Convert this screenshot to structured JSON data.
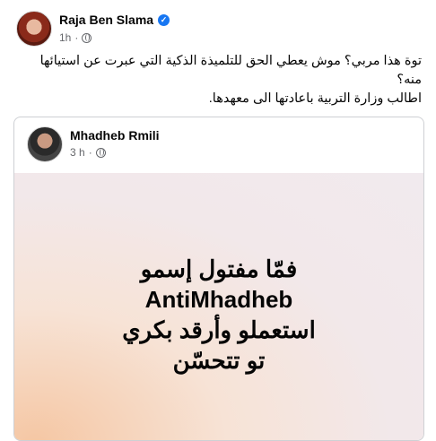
{
  "post": {
    "author": "Raja Ben Slama",
    "verified_icon": "verified-badge-icon",
    "time": "1h",
    "separator": "·",
    "privacy_icon": "globe-icon",
    "text_line1": "توة هذا مربي؟ موش يعطي الحق للتلميذة الذكية التي عبرت عن استيائها",
    "text_line2": "منه؟",
    "text_line3": "اطالب وزارة التربية باعادتها الى معهدها."
  },
  "shared_post": {
    "author": "Mhadheb Rmili",
    "time": "3 h",
    "separator": "·",
    "privacy_icon": "globe-icon",
    "card_line1": "فمّا مفتول إسمو",
    "card_line2": "AntiMhadheb",
    "card_line3": "استعملو وأرقد بكري",
    "card_line4": "تو تتحسّن",
    "card_background": "#f3e6e6"
  },
  "colors": {
    "brand_blue": "#1877f2",
    "meta_gray": "#65676b"
  }
}
